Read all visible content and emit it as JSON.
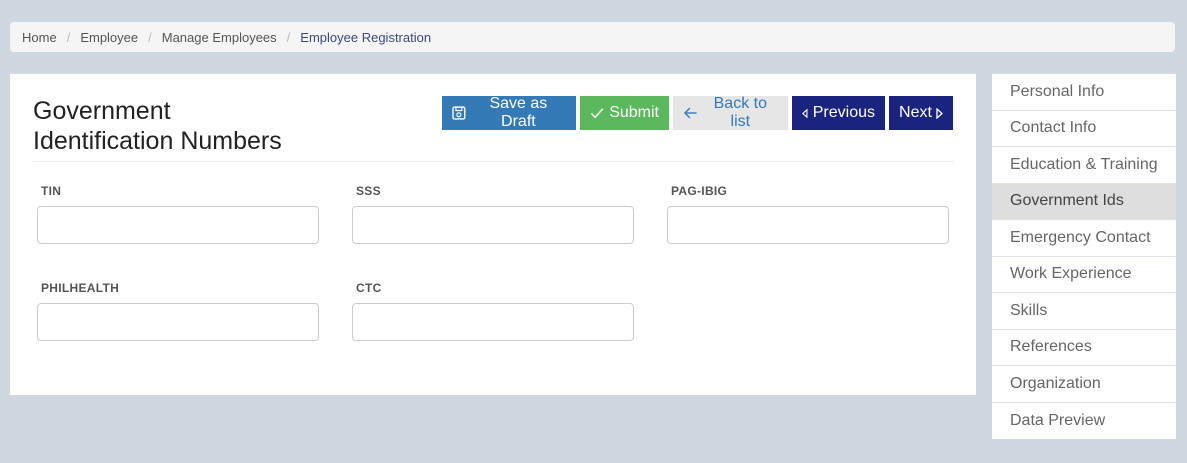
{
  "breadcrumb": {
    "items": [
      "Home",
      "Employee",
      "Manage Employees",
      "Employee Registration"
    ]
  },
  "page": {
    "title_line1": "Government",
    "title_line2": "Identification Numbers"
  },
  "toolbar": {
    "save_draft_label": "Save as Draft",
    "submit_label": "Submit",
    "back_label": "Back to list",
    "previous_label": "Previous",
    "next_label": "Next"
  },
  "form": {
    "tin_label": "TIN",
    "tin_value": "",
    "sss_label": "SSS",
    "sss_value": "",
    "pagibig_label": "PAG-IBIG",
    "pagibig_value": "",
    "philhealth_label": "PHILHEALTH",
    "philhealth_value": "",
    "ctc_label": "CTC",
    "ctc_value": ""
  },
  "sidenav": {
    "items": [
      {
        "label": "Personal Info",
        "active": false
      },
      {
        "label": "Contact Info",
        "active": false
      },
      {
        "label": "Education & Training",
        "active": false
      },
      {
        "label": "Government Ids",
        "active": true
      },
      {
        "label": "Emergency Contact",
        "active": false
      },
      {
        "label": "Work Experience",
        "active": false
      },
      {
        "label": "Skills",
        "active": false
      },
      {
        "label": "References",
        "active": false
      },
      {
        "label": "Organization",
        "active": false
      },
      {
        "label": "Data Preview",
        "active": false
      }
    ]
  },
  "colors": {
    "primary": "#337ab7",
    "success": "#5cb85c",
    "navy": "#1a237e",
    "background": "#cfd8e1"
  },
  "icons": {
    "save": "floppy-icon",
    "submit": "check-icon",
    "back": "arrow-left-icon",
    "previous": "caret-left-icon",
    "next": "caret-right-icon"
  }
}
